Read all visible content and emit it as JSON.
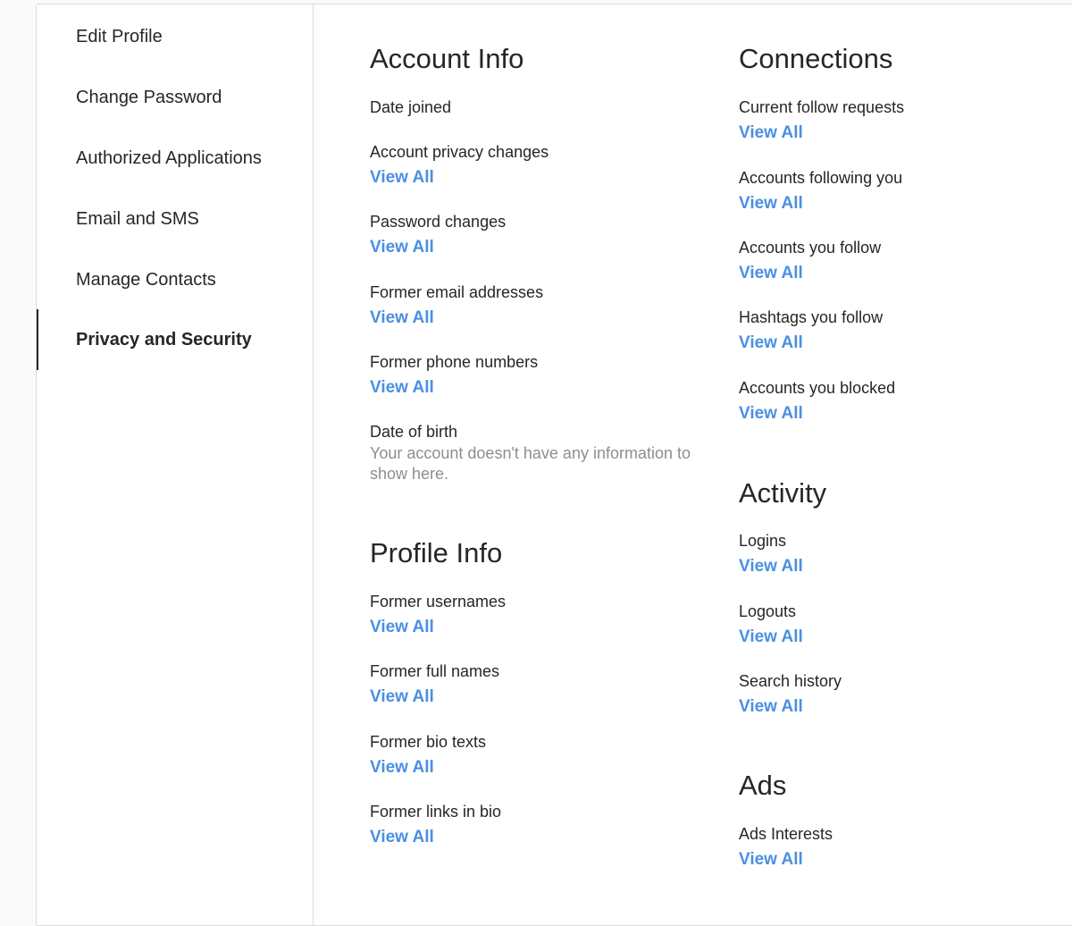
{
  "sidebar": {
    "items": [
      {
        "label": "Edit Profile"
      },
      {
        "label": "Change Password"
      },
      {
        "label": "Authorized Applications"
      },
      {
        "label": "Email and SMS"
      },
      {
        "label": "Manage Contacts"
      },
      {
        "label": "Privacy and Security"
      }
    ]
  },
  "account_info": {
    "title": "Account Info",
    "date_joined": "Date joined",
    "privacy_changes": "Account privacy changes",
    "password_changes": "Password changes",
    "former_emails": "Former email addresses",
    "former_phones": "Former phone numbers",
    "date_of_birth": "Date of birth",
    "empty_message": "Your account doesn't have any information to show here."
  },
  "profile_info": {
    "title": "Profile Info",
    "former_usernames": "Former usernames",
    "former_full_names": "Former full names",
    "former_bio_texts": "Former bio texts",
    "former_links": "Former links in bio"
  },
  "connections": {
    "title": "Connections",
    "follow_requests": "Current follow requests",
    "following_you": "Accounts following you",
    "you_follow": "Accounts you follow",
    "hashtags": "Hashtags you follow",
    "blocked": "Accounts you blocked"
  },
  "activity": {
    "title": "Activity",
    "logins": "Logins",
    "logouts": "Logouts",
    "search_history": "Search history"
  },
  "ads": {
    "title": "Ads",
    "interests": "Ads Interests"
  },
  "common": {
    "view_all": "View All"
  },
  "colors": {
    "link": "#4a90e2",
    "muted": "#8e8e8e",
    "text": "#262626",
    "border": "#dbdbdb"
  }
}
